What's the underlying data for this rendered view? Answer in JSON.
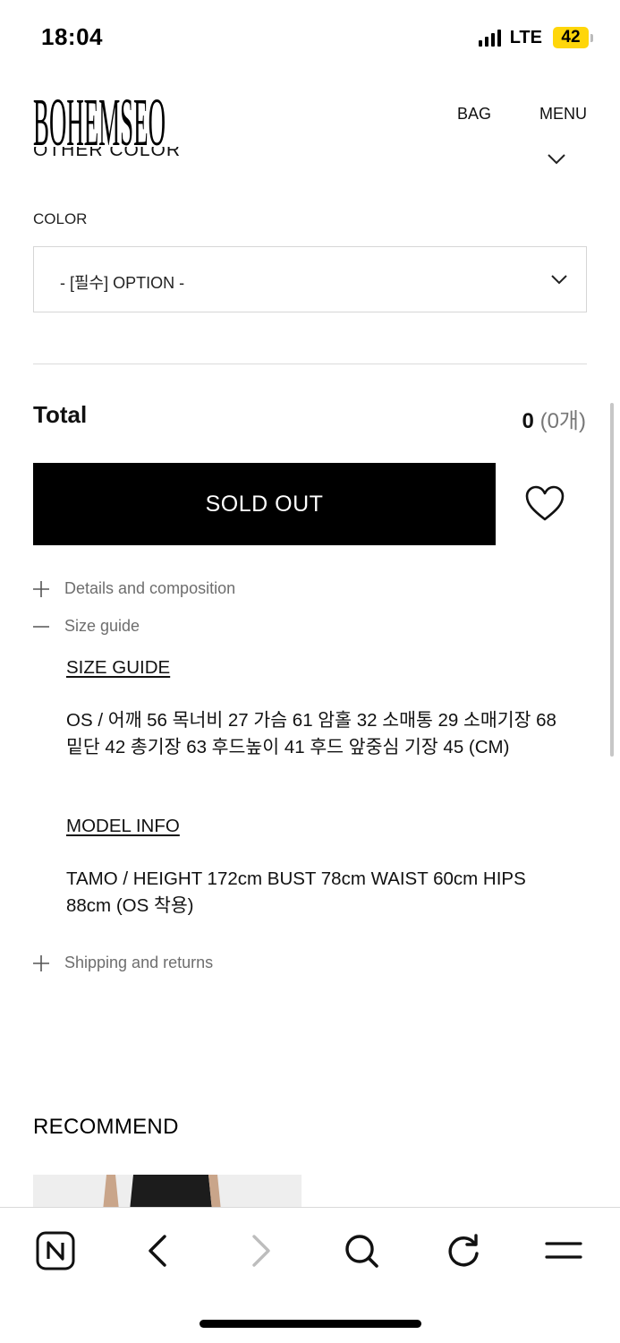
{
  "status_bar": {
    "time": "18:04",
    "network": "LTE",
    "battery": "42"
  },
  "header": {
    "logo_text": "BOHEMSEO",
    "bag_label": "BAG",
    "menu_label": "MENU"
  },
  "other_color_label": "OTHER COLOR",
  "option": {
    "label": "COLOR",
    "selected": "- [필수] OPTION -"
  },
  "total": {
    "label": "Total",
    "amount": "0",
    "count": "(0개)"
  },
  "buttons": {
    "sold_out": "SOLD OUT"
  },
  "accordion": {
    "details": "Details and composition",
    "size_guide": "Size guide",
    "shipping": "Shipping and returns"
  },
  "size_guide": {
    "title": "SIZE GUIDE",
    "measurements": "OS / 어깨 56 목너비 27 가슴 61 암홀 32 소매통 29 소매기장 68 밑단 42 총기장 63 후드높이 41 후드 앞중심 기장 45 (CM)",
    "model_title": "MODEL INFO",
    "model_info": "TAMO / HEIGHT 172cm BUST 78cm WAIST 60cm HIPS 88cm (OS 착용)"
  },
  "recommend": {
    "title": "RECOMMEND"
  },
  "toolbar_icons": [
    "naver-home-icon",
    "back-icon",
    "forward-icon",
    "search-icon",
    "refresh-icon",
    "menu-icon"
  ]
}
